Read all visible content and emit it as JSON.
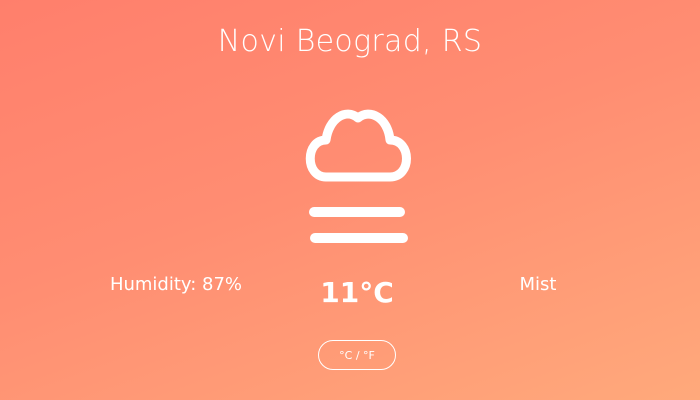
{
  "location": {
    "name": "Novi Beograd, RS"
  },
  "weather": {
    "icon": "mist-cloud-icon",
    "humidity_text": "Humidity: 87%",
    "temperature_text": "11°C",
    "condition_text": "Mist"
  },
  "controls": {
    "unit_toggle_label": "°C / °F"
  },
  "colors": {
    "gradient_start": "#ff7f6c",
    "gradient_end": "#ffa97b",
    "text": "#ffffff"
  }
}
